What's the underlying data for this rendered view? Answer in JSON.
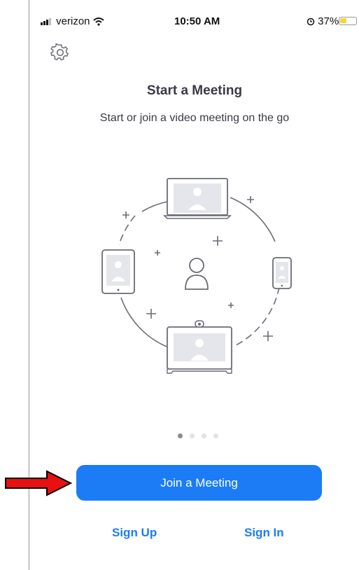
{
  "status_bar": {
    "carrier": "verizon",
    "time": "10:50 AM",
    "battery": "37%"
  },
  "header": {
    "settings_icon": "gear-icon"
  },
  "main": {
    "title": "Start a Meeting",
    "subtitle": "Start or join a video meeting on the go"
  },
  "pagination": {
    "total": 4,
    "active_index": 0
  },
  "actions": {
    "join_label": "Join a Meeting",
    "signup_label": "Sign Up",
    "signin_label": "Sign In"
  },
  "colors": {
    "accent": "#1b7cf5",
    "text": "#3a3a45",
    "annotation_arrow": "#e81010"
  }
}
